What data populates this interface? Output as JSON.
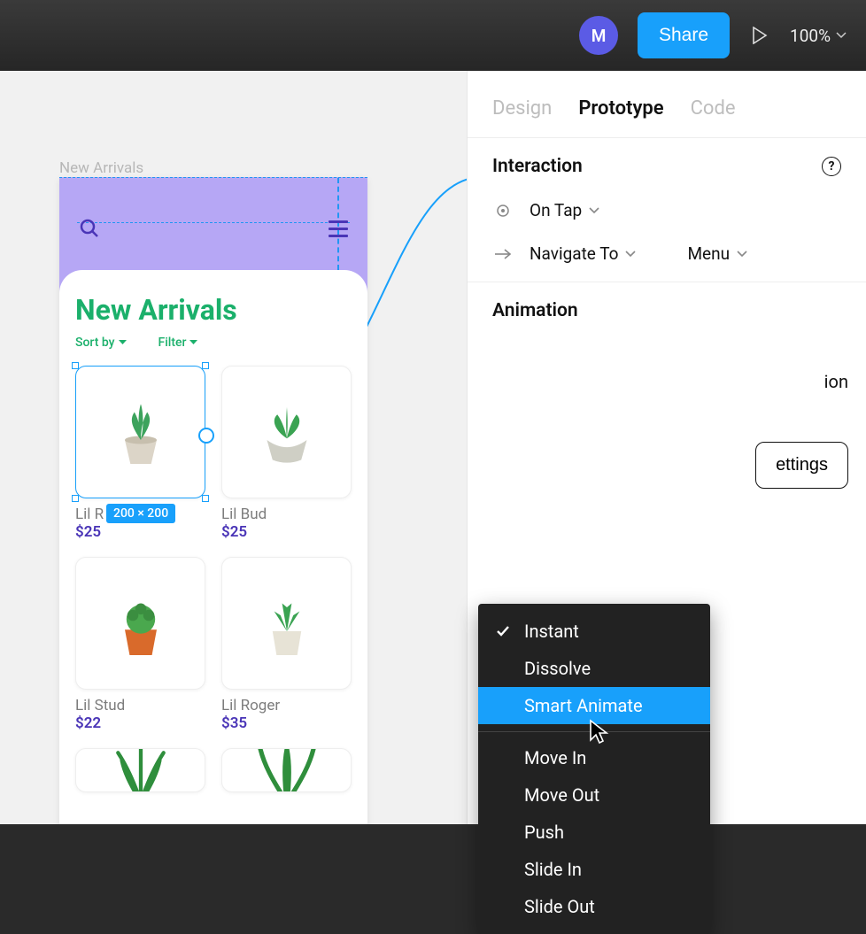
{
  "toolbar": {
    "avatar_letter": "M",
    "share_label": "Share",
    "zoom": "100%"
  },
  "canvas": {
    "frame_label": "New Arrivals",
    "sheet_title": "New Arrivals",
    "sort_label": "Sort by",
    "filter_label": "Filter",
    "selection_dims": "200 × 200",
    "products": [
      {
        "name": "Lil R",
        "price": "$25"
      },
      {
        "name": "Lil Bud",
        "price": "$25"
      },
      {
        "name": "Lil Stud",
        "price": "$22"
      },
      {
        "name": "Lil Roger",
        "price": "$35"
      }
    ]
  },
  "panel": {
    "tabs": {
      "design": "Design",
      "prototype": "Prototype",
      "code": "Code",
      "active": "Prototype"
    },
    "interaction": {
      "title": "Interaction",
      "trigger": "On Tap",
      "action": "Navigate To",
      "target": "Menu"
    },
    "animation": {
      "title": "Animation",
      "settings_btn": "Settings",
      "peek_word": "ion",
      "peek_btn_fragment": "ettings",
      "menu": {
        "selected": "Instant",
        "highlighted": "Smart Animate",
        "items_top": [
          "Instant",
          "Dissolve",
          "Smart Animate"
        ],
        "items_bottom": [
          "Move In",
          "Move Out",
          "Push",
          "Slide In",
          "Slide Out"
        ]
      }
    }
  }
}
